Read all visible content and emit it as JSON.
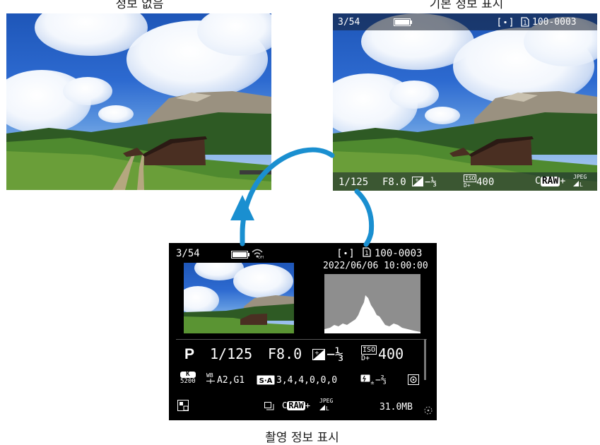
{
  "labels": {
    "no_info": "정보 없음",
    "basic_info": "기본 정보 표시",
    "shooting_info": "촬영 정보 표시"
  },
  "basic_display": {
    "frame_counter": "3/54",
    "folder_file": "100-0003",
    "shutter": "1/125",
    "aperture": "F8.0",
    "exposure_comp": "−⅓",
    "iso": "400",
    "iso_badge": "ISO",
    "d_plus": "D+",
    "quality_raw": "RAW",
    "quality_raw_prefix": "C",
    "quality_jpeg": "JPEG"
  },
  "shooting_display": {
    "frame_counter": "3/54",
    "folder_file": "100-0003",
    "datetime": "2022/06/06 10:00:00",
    "mode": "P",
    "shutter": "1/125",
    "aperture": "F8.0",
    "exposure_comp": "−⅓",
    "iso": "400",
    "iso_badge": "ISO",
    "d_plus": "D+",
    "wb_badge": "K",
    "wb_kelvin": "5200",
    "wb_shift": "A2,G1",
    "picture_style_values": "3,4,4,0,0,0",
    "flash_comp": "−⅔",
    "quality_raw": "RAW",
    "quality_raw_prefix": "C",
    "quality_jpeg": "JPEG",
    "file_size": "31.0MB",
    "wb_shift_label": "WB"
  },
  "colors": {
    "arrow": "#1a8fd0",
    "screen_bg": "#000000",
    "histogram_bg": "#8e8e8e"
  },
  "icons": {
    "battery": "battery-icon",
    "wifi": "wifi-icon",
    "metering": "metering-icon",
    "card": "card-icon",
    "exposure_comp": "exposure-compensation-icon",
    "flash_comp": "flash-compensation-icon",
    "picture_style": "picture-style-icon",
    "metering_mode": "metering-mode-icon",
    "drive": "drive-mode-icon",
    "protect": "protect-icon"
  }
}
